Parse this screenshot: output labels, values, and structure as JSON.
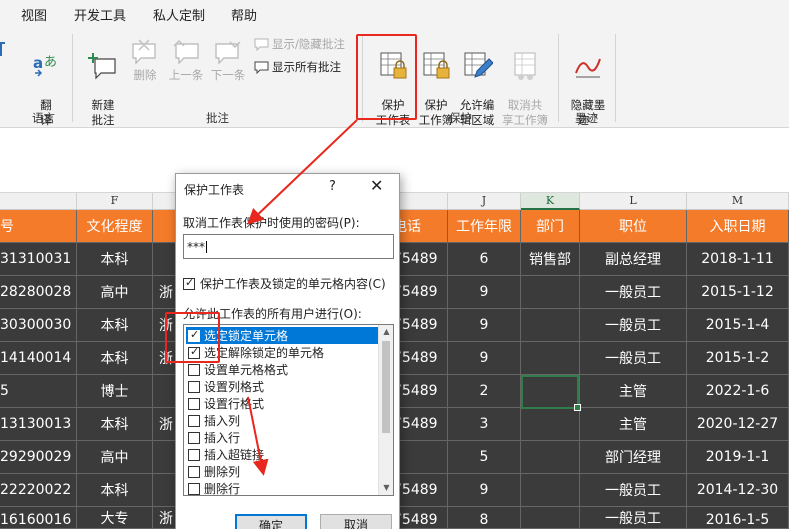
{
  "menu": [
    "视图",
    "开发工具",
    "私人定制",
    "帮助"
  ],
  "ribbon": {
    "language": {
      "button": "翻\n译",
      "group": "语言"
    },
    "comments": {
      "new": "新建\n批注",
      "delete": "删除",
      "prev": "上一条",
      "next": "下一条",
      "show_hide": "显示/隐藏批注",
      "show_all": "显示所有批注",
      "group": "批注"
    },
    "protect": {
      "sheet": "保护\n工作表",
      "workbook": "保护\n工作簿",
      "allow_edit": "允许编\n辑区域",
      "unshare": "取消共\n享工作簿",
      "group": "保护"
    },
    "ink": {
      "hide": "隐藏墨\n迹 ˅",
      "group": "墨迹"
    }
  },
  "columns": [
    "F",
    "J",
    "K",
    "L",
    "M"
  ],
  "table": {
    "headers": [
      "号",
      "文化程度",
      "电话",
      "工作年限",
      "部门",
      "职位",
      "入职日期"
    ],
    "rows": [
      [
        "31310031",
        "本科",
        "",
        "75489",
        "6",
        "销售部",
        "副总经理",
        "2018-1-11"
      ],
      [
        "28280028",
        "高中",
        "浙",
        "75489",
        "9",
        "",
        "一般员工",
        "2015-1-12"
      ],
      [
        "30300030",
        "本科",
        "浙",
        "75489",
        "9",
        "",
        "一般员工",
        "2015-1-4"
      ],
      [
        "14140014",
        "本科",
        "浙",
        "75489",
        "9",
        "",
        "一般员工",
        "2015-1-2"
      ],
      [
        "5",
        "博士",
        "",
        "75489",
        "2",
        "",
        "主管",
        "2022-1-6"
      ],
      [
        "13130013",
        "本科",
        "浙",
        "75489",
        "3",
        "",
        "主管",
        "2020-12-27"
      ],
      [
        "29290029",
        "高中",
        "",
        "",
        "5",
        "",
        "部门经理",
        "2019-1-1"
      ],
      [
        "22220022",
        "本科",
        "",
        "75489",
        "9",
        "",
        "一般员工",
        "2014-12-30"
      ],
      [
        "16160016",
        "大专",
        "浙",
        "75489",
        "8",
        "",
        "一般员工",
        "2016-1-5"
      ]
    ]
  },
  "dialog": {
    "title": "保护工作表",
    "help": "?",
    "close": "✕",
    "password_label": "取消工作表保护时使用的密码(P):",
    "password_value": "***",
    "protect_check": "保护工作表及锁定的单元格内容(C)",
    "allow_label": "允许此工作表的所有用户进行(O):",
    "options": [
      {
        "label": "选定锁定单元格",
        "checked": true
      },
      {
        "label": "选定解除锁定的单元格",
        "checked": true
      },
      {
        "label": "设置单元格格式",
        "checked": false
      },
      {
        "label": "设置列格式",
        "checked": false
      },
      {
        "label": "设置行格式",
        "checked": false
      },
      {
        "label": "插入列",
        "checked": false
      },
      {
        "label": "插入行",
        "checked": false
      },
      {
        "label": "插入超链接",
        "checked": false
      },
      {
        "label": "删除列",
        "checked": false
      },
      {
        "label": "删除行",
        "checked": false
      }
    ],
    "ok": "确定",
    "cancel": "取消"
  },
  "colors": {
    "header_orange": "#f47b2a",
    "data_dark": "#3b3b3b",
    "annotation_red": "#e8281e",
    "selection_blue": "#0078d7"
  }
}
